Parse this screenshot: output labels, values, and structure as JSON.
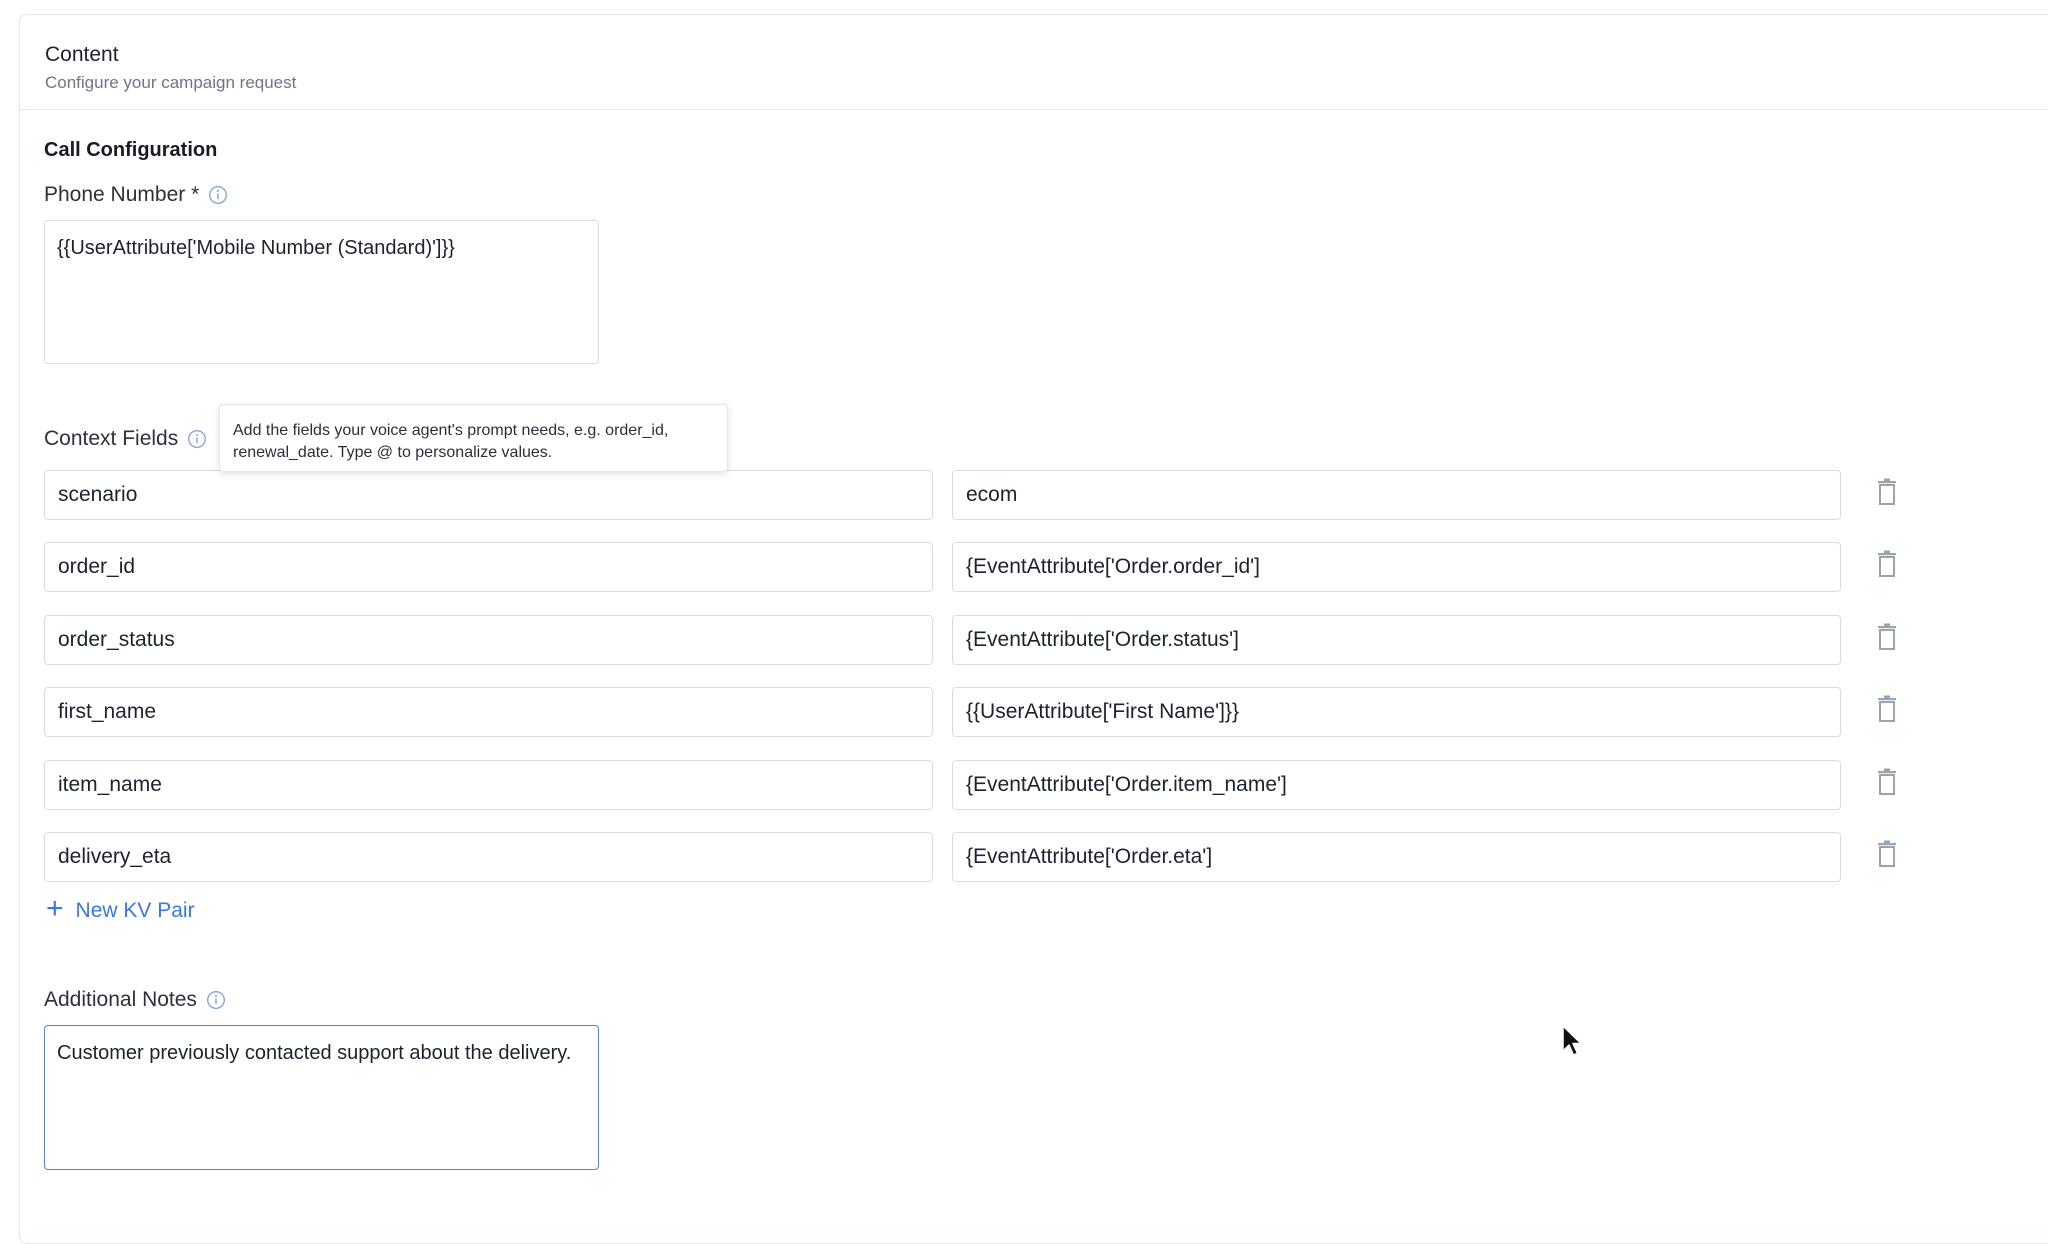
{
  "header": {
    "title": "Content",
    "subtitle": "Configure your campaign request"
  },
  "call_config": {
    "section_title": "Call Configuration",
    "phone_label": "Phone Number *",
    "phone_value": "{{UserAttribute['Mobile Number (Standard)']}}",
    "context_label": "Context Fields",
    "tooltip": "Add the fields your voice agent's prompt needs, e.g. order_id, renewal_date. Type @ to personalize values.",
    "kv_pairs": [
      {
        "key": "scenario",
        "value": "ecom"
      },
      {
        "key": "order_id",
        "value": "{EventAttribute['Order.order_id']"
      },
      {
        "key": "order_status",
        "value": "{EventAttribute['Order.status']"
      },
      {
        "key": "first_name",
        "value": "{{UserAttribute['First Name']}}"
      },
      {
        "key": "item_name",
        "value": "{EventAttribute['Order.item_name']"
      },
      {
        "key": "delivery_eta",
        "value": "{EventAttribute['Order.eta']"
      }
    ],
    "add_kv_label": "New KV Pair",
    "notes_label": "Additional Notes",
    "notes_value": "Customer previously contacted support about the delivery."
  },
  "icons": {
    "info": "info-circle-icon",
    "delete": "trash-icon",
    "add": "plus-icon",
    "cursor": "mouse-pointer-icon"
  },
  "colors": {
    "accent": "#3b77e3",
    "focus_border": "#4c84e6",
    "border": "#d9dde3",
    "muted_text": "#6c7686",
    "icon_gray": "#9aa3b0"
  }
}
